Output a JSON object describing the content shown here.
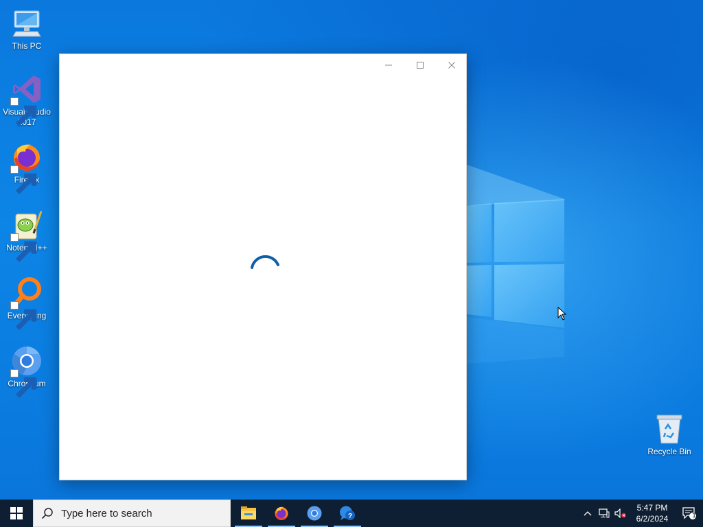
{
  "desktop": {
    "icons": [
      {
        "label": "This PC",
        "icon": "computer-icon"
      },
      {
        "label": "Visual Studio 2017",
        "icon": "visual-studio-icon"
      },
      {
        "label": "Firefox",
        "icon": "firefox-icon"
      },
      {
        "label": "Notepad++",
        "icon": "notepadpp-icon"
      },
      {
        "label": "Everything",
        "icon": "everything-search-icon"
      },
      {
        "label": "Chromium",
        "icon": "chromium-icon"
      },
      {
        "label": "Recycle Bin",
        "icon": "recycle-bin-icon"
      }
    ]
  },
  "window": {
    "state": "loading",
    "caption_buttons": [
      "minimize-icon",
      "maximize-icon",
      "close-icon"
    ]
  },
  "taskbar": {
    "search_placeholder": "Type here to search",
    "pinned": [
      {
        "icon": "file-explorer-icon",
        "active": true
      },
      {
        "icon": "firefox-icon",
        "active": true
      },
      {
        "icon": "chromium-icon",
        "active": true
      },
      {
        "icon": "help-app-icon",
        "active": true
      }
    ],
    "clock_time": "5:47 PM",
    "clock_date": "6/2/2024",
    "notification_count": "1"
  },
  "colors": {
    "wallpaper": "#0b78de",
    "taskbar": "#0f1f33",
    "spinner": "#0f5fa8"
  }
}
